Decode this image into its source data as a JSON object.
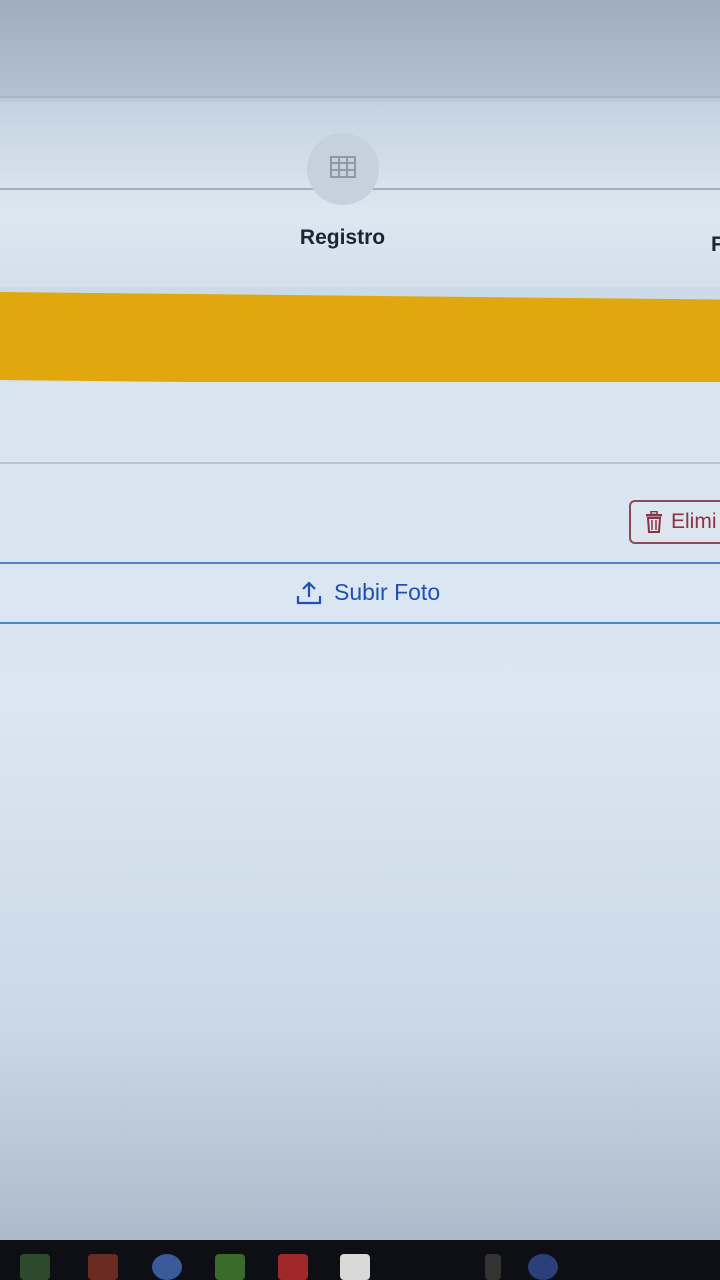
{
  "tabs": {
    "active_label": "Registro",
    "next_label_fragment": "F",
    "active_icon": "table-icon"
  },
  "actions": {
    "delete_label": "Elimi",
    "delete_icon": "trash-icon",
    "upload_label": "Subir Foto",
    "upload_icon": "upload-icon"
  },
  "colors": {
    "accent_yellow": "#e0a80e",
    "link_blue": "#2150b3",
    "danger": "#8a3346"
  },
  "taskbar": {
    "icons": [
      "terminal-icon",
      "app-icon",
      "chrome-icon",
      "note-icon",
      "remote-icon",
      "w-icon",
      "chevron-up-icon",
      "globe-icon"
    ]
  }
}
